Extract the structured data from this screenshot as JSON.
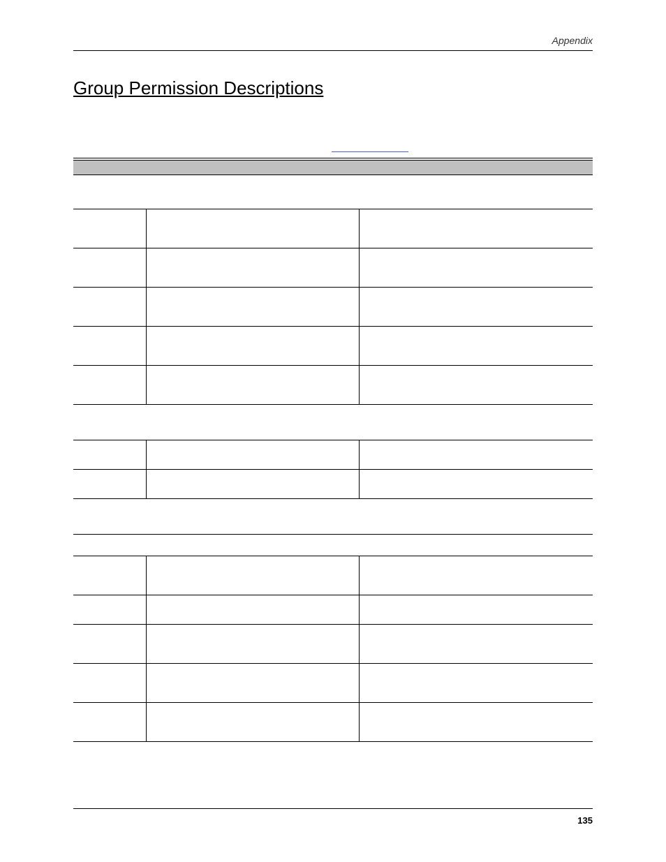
{
  "header": {
    "section": "Appendix"
  },
  "title": "Group Permission Descriptions",
  "tables": {
    "t1_rows": 5,
    "t2_rows": 2,
    "t3_rows": 5
  },
  "footer": {
    "page": "135"
  }
}
